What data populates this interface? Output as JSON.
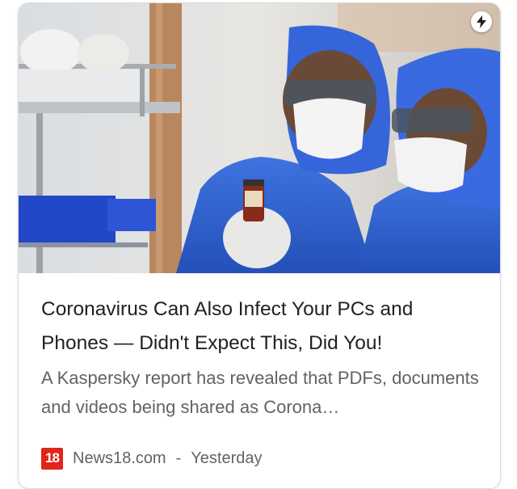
{
  "article": {
    "amp_icon": "lightning-bolt-icon",
    "headline": "Coronavirus Can Also Infect Your PCs and Phones — Didn't Expect This, Did You!",
    "snippet": "A Kaspersky report has revealed that PDFs, documents and videos being shared as Corona…",
    "source": {
      "logo_text": "18",
      "name": "News18.com",
      "separator": "-",
      "time": "Yesterday"
    }
  },
  "colors": {
    "logo_red": "#e1251b",
    "headline": "#202124",
    "secondary_text": "#5f6368",
    "ppe_blue": "#2f5fd0"
  }
}
